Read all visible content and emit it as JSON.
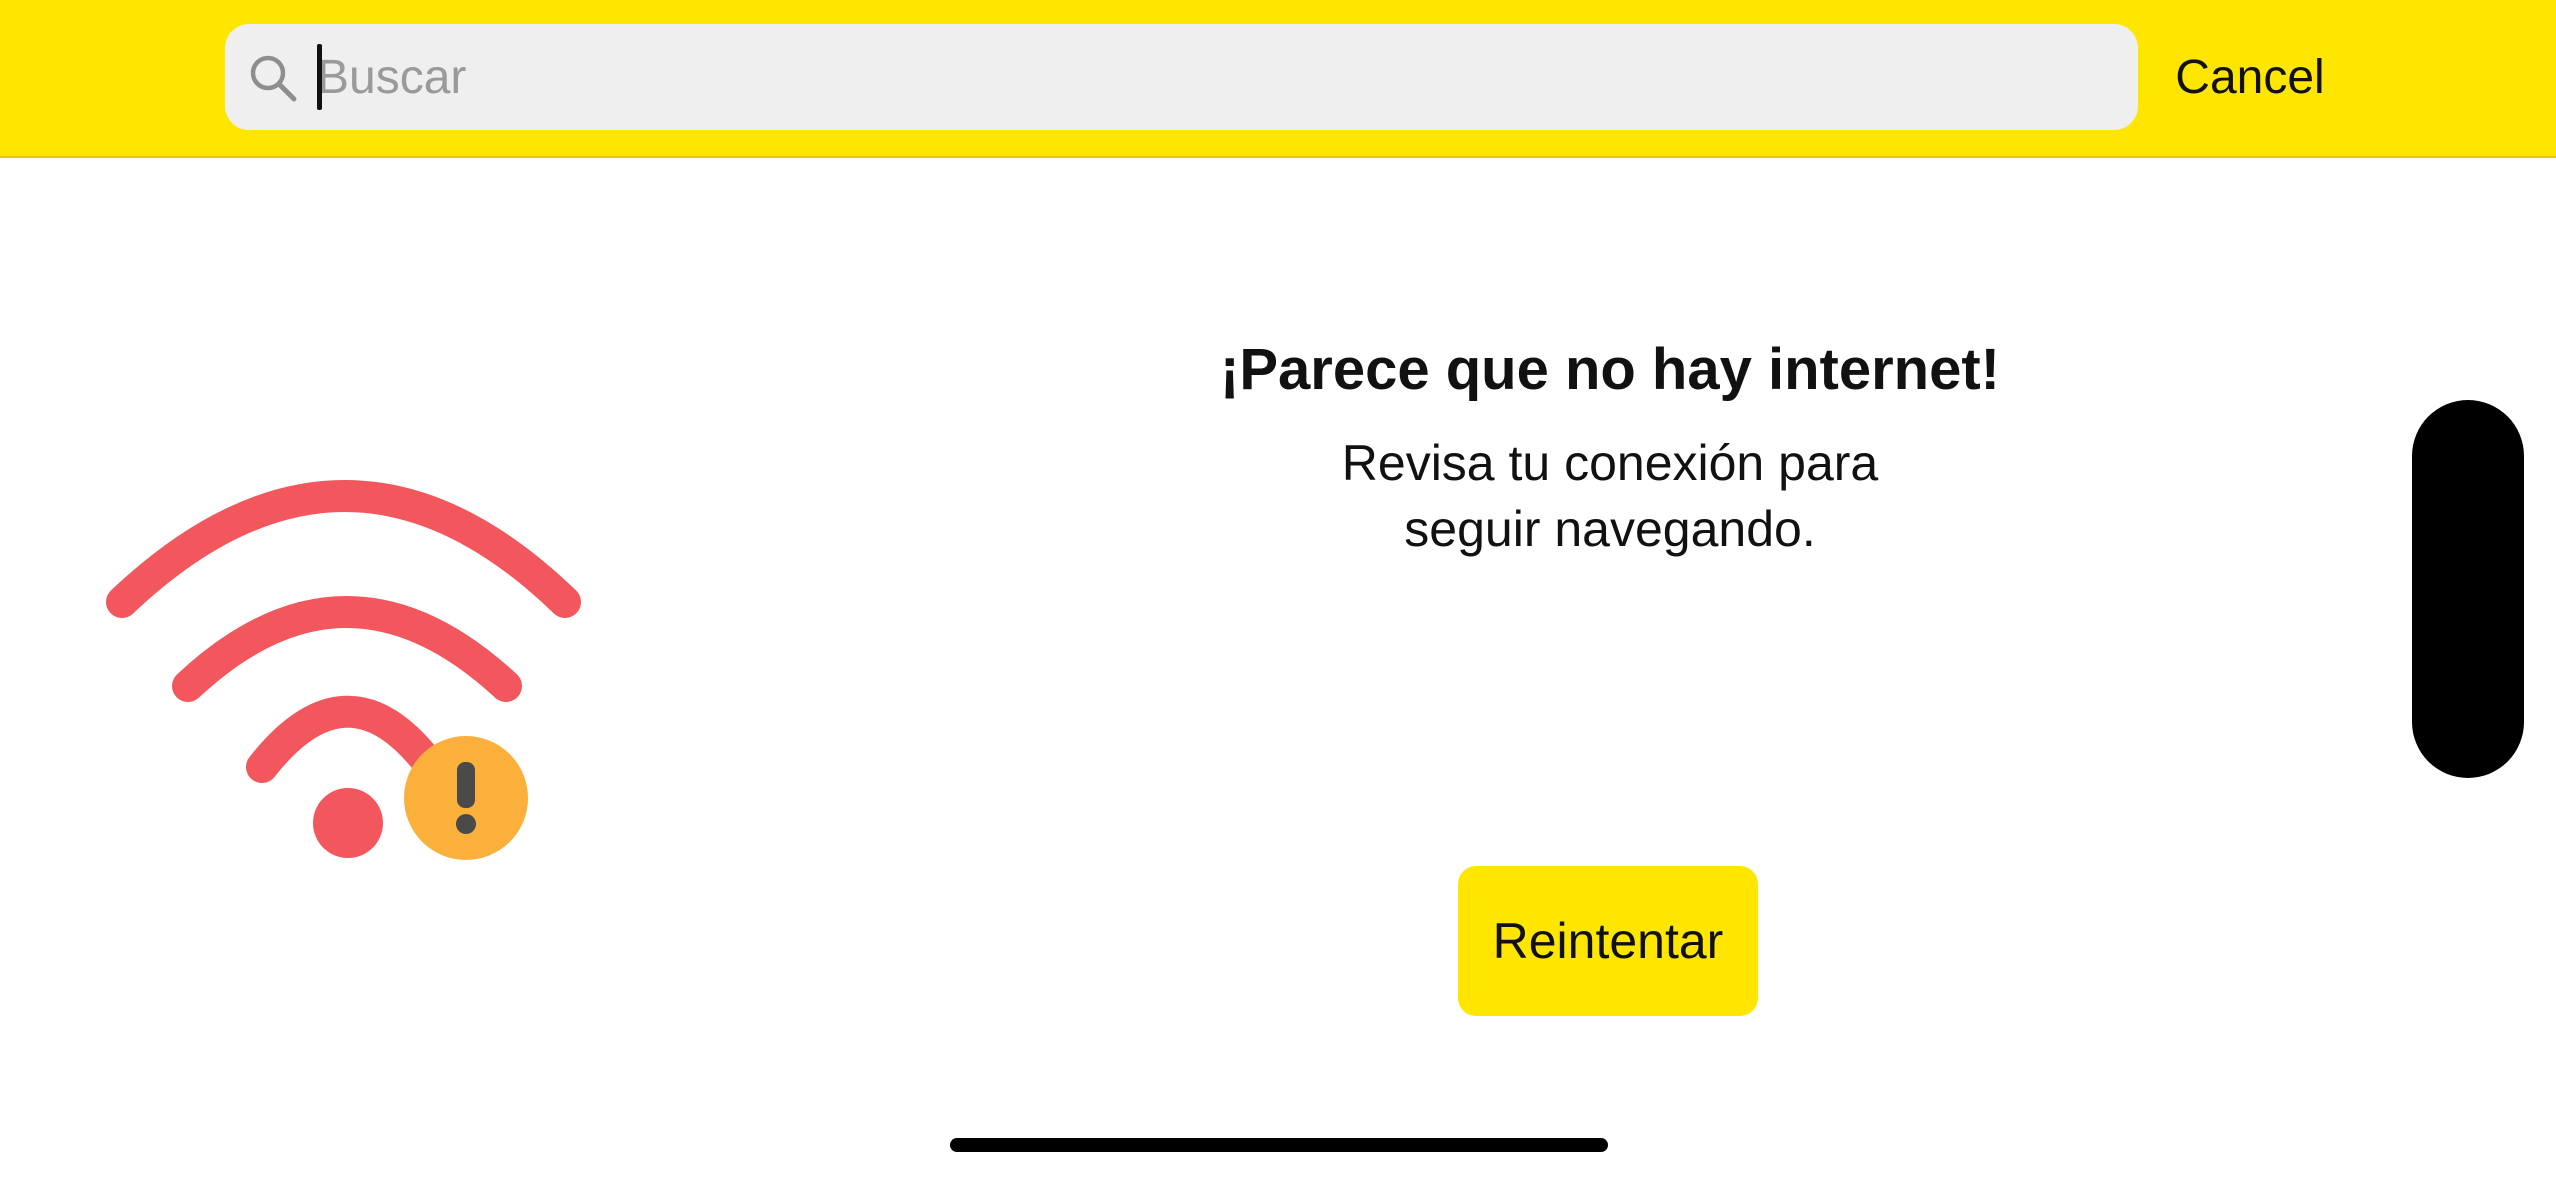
{
  "search": {
    "placeholder": "Buscar",
    "value": "",
    "cancel_label": "Cancel"
  },
  "illustration": {
    "icon": "wifi-warning-icon",
    "wifi_color": "#F2575E",
    "badge_color": "#FBB03B",
    "badge_glyph_color": "#4a4a4a"
  },
  "message": {
    "title": "¡Parece que no hay internet!",
    "subtitle": "Revisa tu conexión para seguir navegando."
  },
  "actions": {
    "retry_label": "Reintentar"
  },
  "colors": {
    "brand_yellow": "#FFE600",
    "search_bg": "#EFEFEF",
    "text": "#111111"
  }
}
